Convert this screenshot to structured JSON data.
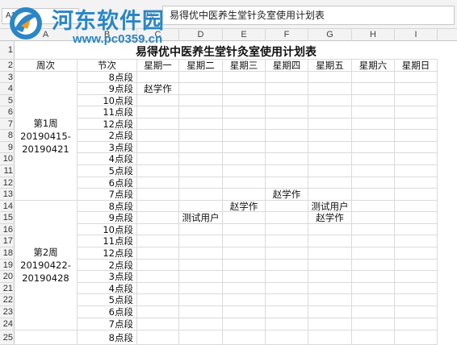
{
  "formula_bar": {
    "name_box": "A1",
    "fx_label": "fx",
    "content": "易得优中医养生堂针灸室使用计划表"
  },
  "watermark": {
    "title": "河东软件园",
    "url": "www.pc0359.cn",
    "accent_color": "#2a86c6",
    "icon": "hedong-logo-icon"
  },
  "columns": [
    "A",
    "B",
    "C",
    "D",
    "E",
    "F",
    "G",
    "H",
    "I"
  ],
  "rows": [
    "1",
    "2",
    "3",
    "4",
    "5",
    "6",
    "7",
    "8",
    "9",
    "10",
    "11",
    "12",
    "13",
    "14",
    "15",
    "16",
    "17",
    "18",
    "19",
    "20",
    "21",
    "22",
    "23",
    "24",
    "25"
  ],
  "sheet": {
    "title": "易得优中医养生堂针灸室使用计划表",
    "headers": [
      "周次",
      "节次",
      "星期一",
      "星期二",
      "星期三",
      "星期四",
      "星期五",
      "星期六",
      "星期日"
    ],
    "periods": [
      "8点段",
      "9点段",
      "10点段",
      "11点段",
      "12点段",
      "2点段",
      "3点段",
      "4点段",
      "5点段",
      "6点段",
      "7点段"
    ],
    "weeks": [
      {
        "line1": "第1周",
        "line2": "20190415-",
        "line3": "20190421"
      },
      {
        "line1": "第2周",
        "line2": "20190422-",
        "line3": "20190428"
      }
    ],
    "entries": [
      {
        "row": 4,
        "col": "C",
        "text": "赵学作"
      },
      {
        "row": 13,
        "col": "F",
        "text": "赵学作"
      },
      {
        "row": 14,
        "col": "E",
        "text": "赵学作"
      },
      {
        "row": 14,
        "col": "G",
        "text": "测试用户"
      },
      {
        "row": 15,
        "col": "D",
        "text": "测试用户"
      },
      {
        "row": 15,
        "col": "G",
        "text": "赵学作"
      }
    ]
  }
}
